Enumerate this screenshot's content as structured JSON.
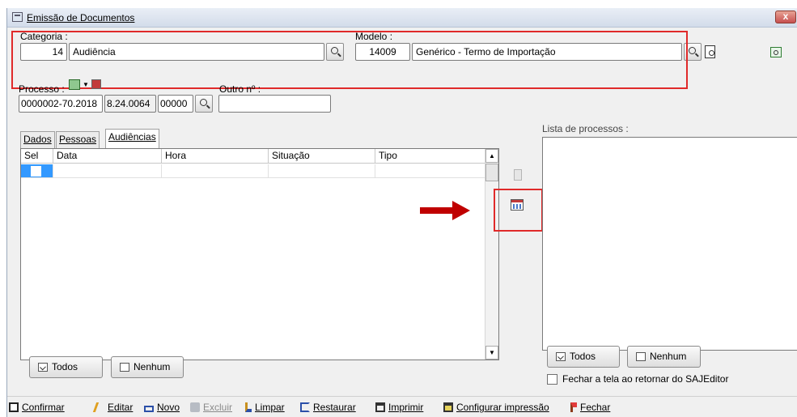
{
  "window": {
    "title": "Emissão de Documentos",
    "close_glyph": "x"
  },
  "categoria": {
    "label": "Categoria :",
    "code": "14",
    "name": "Audiência"
  },
  "modelo": {
    "label": "Modelo :",
    "code": "14009",
    "name": "Genérico -  Termo de Importação"
  },
  "processo": {
    "label": "Processo :",
    "part1": "0000002-70.2018",
    "part2": "8.24.0064",
    "part3": "00000"
  },
  "outro": {
    "label": "Outro nº :",
    "value": ""
  },
  "tabs": [
    {
      "label": "Dados"
    },
    {
      "label": "Pessoas"
    },
    {
      "label": "Audiências"
    }
  ],
  "grid": {
    "columns": [
      "Sel",
      "Data",
      "Hora",
      "Situação",
      "Tipo"
    ]
  },
  "lista": {
    "label": "Lista de processos :"
  },
  "left_buttons": {
    "todos": "Todos",
    "nenhum": "Nenhum"
  },
  "right_buttons": {
    "todos": "Todos",
    "nenhum": "Nenhum"
  },
  "fechar_check": {
    "label": "Fechar a tela ao retornar do SAJEditor",
    "checked": false
  },
  "toolbar": {
    "confirmar": "Confirmar",
    "editar": "Editar",
    "novo": "Novo",
    "excluir": "Excluir",
    "limpar": "Limpar",
    "restaurar": "Restaurar",
    "imprimir": "Imprimir",
    "configurar": "Configurar impressão",
    "fechar": "Fechar"
  },
  "colors": {
    "annotation_red": "#e02a2a",
    "arrow_red": "#c00000",
    "selection_blue": "#3399ff"
  }
}
